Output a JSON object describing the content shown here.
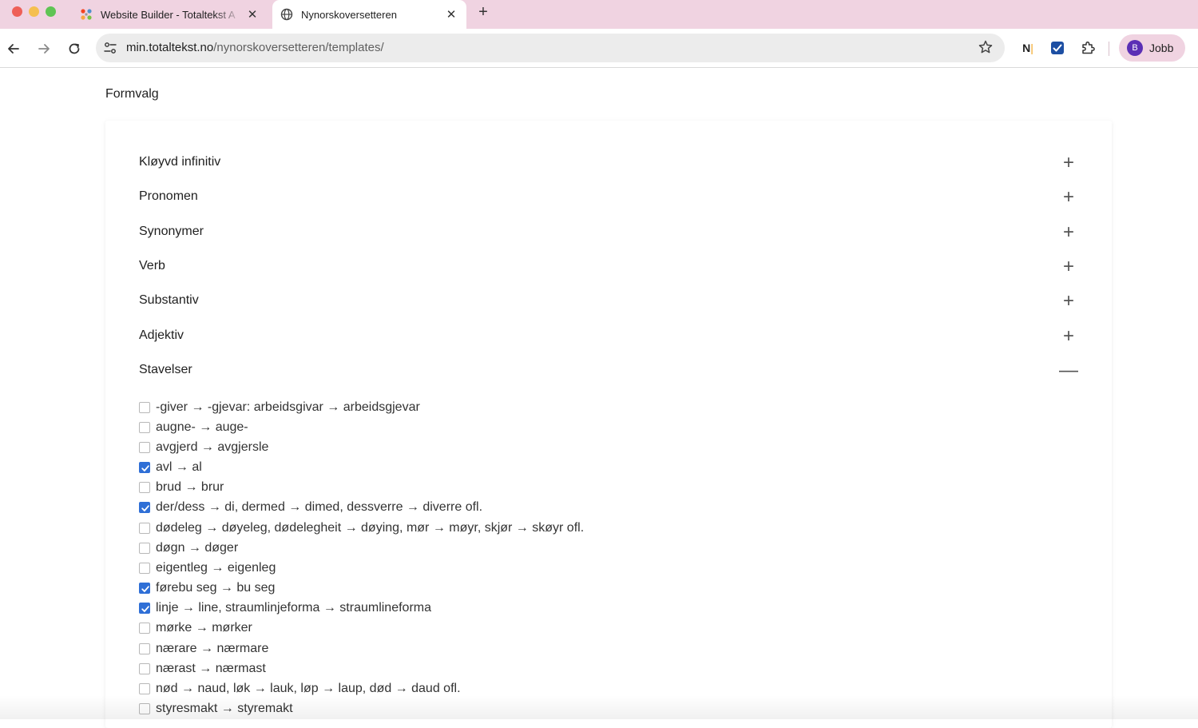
{
  "browser": {
    "tabs": [
      {
        "title": "Website Builder - Totaltekst A",
        "icon": "joomla-icon",
        "active": false
      },
      {
        "title": "Nynorskoversetteren",
        "icon": "globe-icon",
        "active": true
      }
    ],
    "close_glyph": "✕",
    "new_tab_glyph": "+",
    "url_host": "min.totaltekst.no",
    "url_path": "/nynorskoversetteren/templates/",
    "extension_n": "N",
    "extension_n_bar": "|",
    "profile_initial": "B",
    "profile_name": "Jobb"
  },
  "page": {
    "title": "Formvalg",
    "sections": [
      {
        "label": "Kløyvd infinitiv",
        "toggle": "+"
      },
      {
        "label": "Pronomen",
        "toggle": "+"
      },
      {
        "label": "Synonymer",
        "toggle": "+"
      },
      {
        "label": "Verb",
        "toggle": "+"
      },
      {
        "label": "Substantiv",
        "toggle": "+"
      },
      {
        "label": "Adjektiv",
        "toggle": "+"
      },
      {
        "label": "Stavelser",
        "toggle": "—"
      }
    ],
    "stavelser_options": [
      {
        "text": "-giver → -gjevar: arbeidsgivar → arbeidsgjevar",
        "checked": false
      },
      {
        "text": "augne- → auge-",
        "checked": false
      },
      {
        "text": "avgjerd → avgjersle",
        "checked": false
      },
      {
        "text": "avl → al",
        "checked": true
      },
      {
        "text": "brud → brur",
        "checked": false
      },
      {
        "text": "der/dess → di, dermed → dimed, dessverre → diverre ofl.",
        "checked": true
      },
      {
        "text": "dødeleg → døyeleg, dødelegheit → døying, mør → møyr, skjør → skøyr ofl.",
        "checked": false
      },
      {
        "text": "døgn → døger",
        "checked": false
      },
      {
        "text": "eigentleg → eigenleg",
        "checked": false
      },
      {
        "text": "førebu seg → bu seg",
        "checked": true
      },
      {
        "text": "linje → line, straumlinjeforma → straumlineforma",
        "checked": true
      },
      {
        "text": "mørke → mørker",
        "checked": false
      },
      {
        "text": "nærare → nærmare",
        "checked": false
      },
      {
        "text": "nærast → nærmast",
        "checked": false
      },
      {
        "text": "nød → naud, løk → lauk, løp → laup, død → daud ofl.",
        "checked": false
      },
      {
        "text": "styresmakt → styremakt",
        "checked": false
      }
    ]
  },
  "colors": {
    "tabbar": "#f0d3e1",
    "checkbox_accent": "#2f6fd6"
  }
}
